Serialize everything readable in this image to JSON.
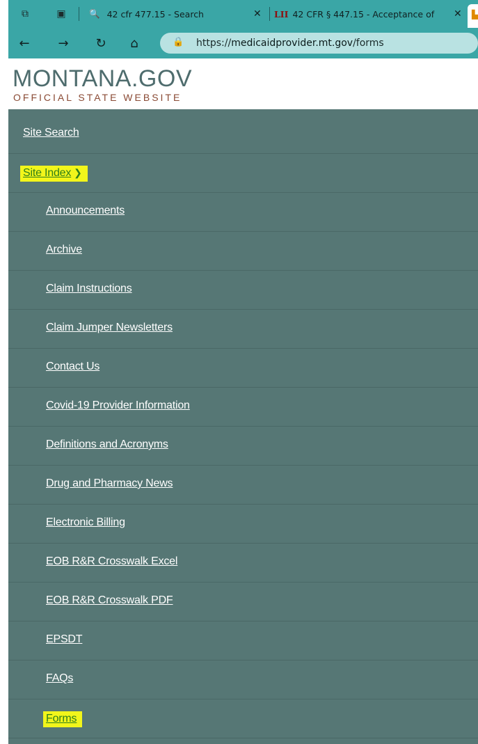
{
  "browser": {
    "tabs": [
      {
        "icon": "search-icon",
        "title": "42 cfr 477.15 - Search",
        "close": "✕"
      },
      {
        "icon": "lii-favicon",
        "favicon_text": "LII",
        "title": "42 CFR § 447.15 - Acceptance of",
        "close": "✕"
      }
    ],
    "url": {
      "prefix": "https://",
      "host": "medicaidprovider.mt.gov",
      "path": "/forms"
    },
    "accent": "#3aa6a6"
  },
  "header": {
    "logo_main": "MONTANA.GOV",
    "logo_sub": "OFFICIAL STATE WEBSITE"
  },
  "menu": {
    "site_search": "Site Search",
    "site_index": "Site Index",
    "items": [
      "Announcements",
      "Archive",
      "Claim Instructions",
      "Claim Jumper Newsletters",
      "Contact Us",
      "Covid-19 Provider Information",
      "Definitions and Acronyms",
      "Drug and Pharmacy News",
      "Electronic Billing",
      "EOB R&R Crosswalk Excel",
      "EOB R&R Crosswalk PDF",
      "EPSDT",
      "FAQs",
      "Forms"
    ],
    "highlighted": [
      "Site Index",
      "Forms"
    ],
    "highlight_color": "#f2f51b",
    "background": "#567775"
  }
}
